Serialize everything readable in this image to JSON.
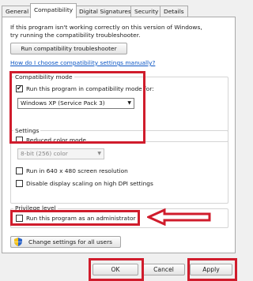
{
  "tabs": [
    {
      "label": "General"
    },
    {
      "label": "Compatibility"
    },
    {
      "label": "Digital Signatures"
    },
    {
      "label": "Security"
    },
    {
      "label": "Details"
    }
  ],
  "intro": {
    "line1": "If this program isn't working correctly on this version of Windows,",
    "line2": "try running the compatibility troubleshooter."
  },
  "troubleshooter_button": "Run compatibility troubleshooter",
  "help_link": "How do I choose compatibility settings manually?",
  "compat_mode": {
    "group_label": "Compatibility mode",
    "checkbox_label": "Run this program in compatibility mode for:",
    "checked": true,
    "selected": "Windows XP (Service Pack 3)"
  },
  "settings": {
    "group_label": "Settings",
    "reduced_color": "Reduced color mode",
    "color_select": "8-bit (256) color",
    "run_640": "Run in 640 x 480 screen resolution",
    "disable_dpi": "Disable display scaling on high DPI settings"
  },
  "privilege": {
    "group_label": "Privilege level",
    "run_admin": "Run this program as an administrator"
  },
  "change_all_button": "Change settings for all users",
  "footer": {
    "ok": "OK",
    "cancel": "Cancel",
    "apply": "Apply"
  },
  "colors": {
    "highlight": "#d01c2c",
    "link": "#0b55c4"
  },
  "icons": {
    "checkmark": "✔",
    "dropdown": "▼"
  }
}
